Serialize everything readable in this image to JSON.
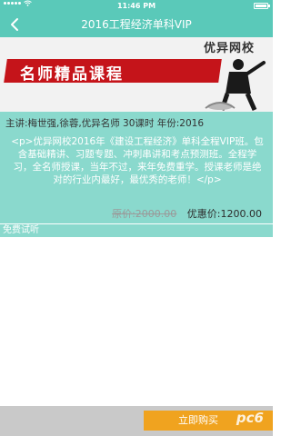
{
  "status_bar": {
    "time": "11:46 PM"
  },
  "nav": {
    "title": "2016工程经济单科VIP"
  },
  "banner": {
    "brand": "优异网校",
    "slogan": "名师精品课程"
  },
  "course": {
    "meta": "主讲:梅世强,徐蓉,优异名师  30课时  年份:2016",
    "description": "<p>优异网校2016年《建设工程经济》单科全程VIP班。包含基础精讲、习题专题、冲刺串讲和考点预测班。全程学习，全名师授课，当年不过，来年免费重学。授课老师是绝对的行业内最好，最优秀的老师！</p>",
    "original_price": "原价:2000.00",
    "sale_price": "优惠价:1200.00"
  },
  "trial": {
    "header": "免费试听"
  },
  "bottom": {
    "buy_label": "立即购买",
    "watermark": "pc6"
  },
  "colors": {
    "primary": "#5ac9b9",
    "panel": "#8ad9cd",
    "buy": "#f0a31f",
    "ribbon": "#c5141a"
  }
}
